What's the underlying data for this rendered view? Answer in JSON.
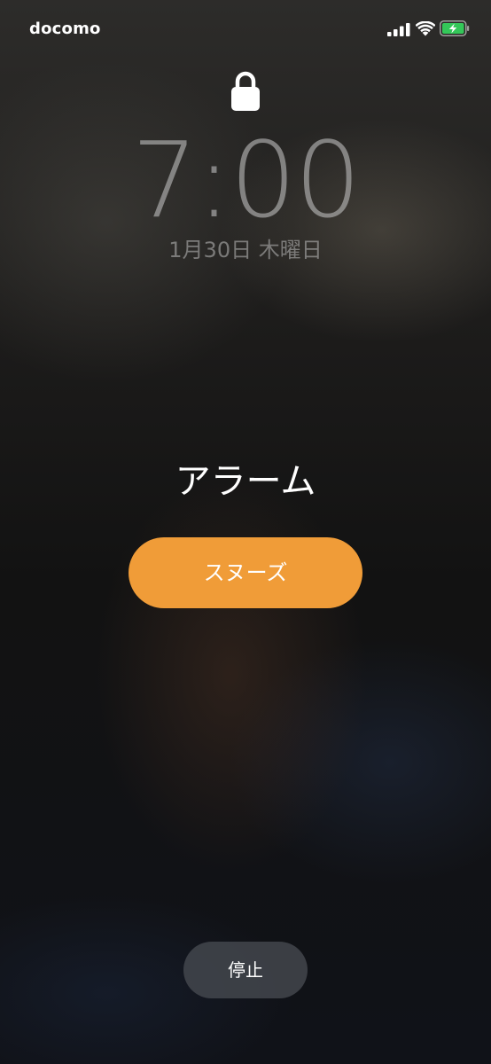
{
  "status_bar": {
    "carrier": "docomo",
    "signal_icon": "cellular-signal-icon",
    "wifi_icon": "wifi-icon",
    "battery_icon": "battery-charging-icon",
    "battery_color": "#34c759"
  },
  "lock_screen": {
    "lock_icon": "lock-icon",
    "time": "7:00",
    "date": "1月30日 木曜日"
  },
  "alarm": {
    "title": "アラーム",
    "snooze_label": "スヌーズ",
    "snooze_color": "#f09c38",
    "stop_label": "停止"
  }
}
